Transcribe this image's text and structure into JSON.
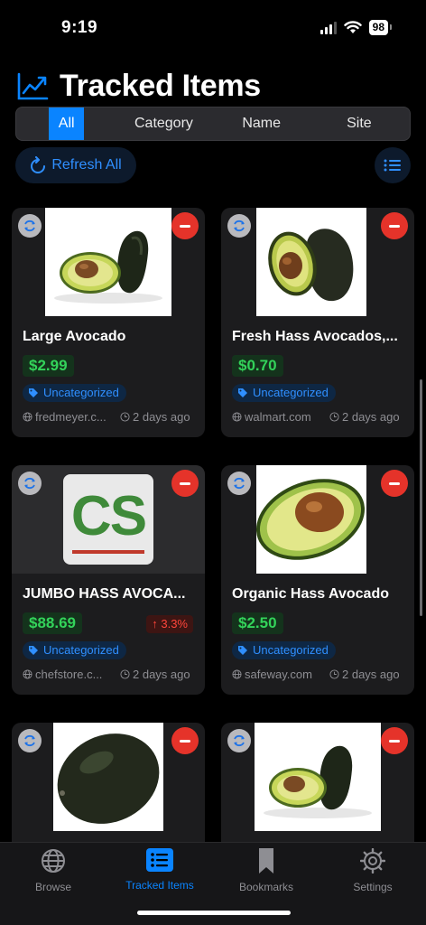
{
  "status_bar": {
    "time": "9:19",
    "battery": "98"
  },
  "header": {
    "title": "Tracked Items",
    "icon": "chart-line-icon"
  },
  "filter": {
    "options": [
      "All",
      "Category",
      "Name",
      "Site"
    ],
    "selected": "All"
  },
  "actions": {
    "refresh_all": "Refresh All"
  },
  "items": [
    {
      "name": "Large Avocado",
      "price": "$2.99",
      "change": "",
      "category": "Uncategorized",
      "site": "fredmeyer.c...",
      "updated": "2 days ago"
    },
    {
      "name": "Fresh Hass Avocados,...",
      "price": "$0.70",
      "change": "",
      "category": "Uncategorized",
      "site": "walmart.com",
      "updated": "2 days ago"
    },
    {
      "name": "JUMBO HASS AVOCA...",
      "price": "$88.69",
      "change": "3.3%",
      "category": "Uncategorized",
      "site": "chefstore.c...",
      "updated": "2 days ago",
      "logo_text": "CS"
    },
    {
      "name": "Organic Hass Avocado",
      "price": "$2.50",
      "change": "",
      "category": "Uncategorized",
      "site": "safeway.com",
      "updated": "2 days ago"
    },
    {
      "name": "",
      "price": "",
      "change": "",
      "category": "",
      "site": "",
      "updated": ""
    },
    {
      "name": "",
      "price": "",
      "change": "",
      "category": "",
      "site": "",
      "updated": ""
    }
  ],
  "tabs": [
    {
      "label": "Browse",
      "icon": "globe-icon"
    },
    {
      "label": "Tracked Items",
      "icon": "list-icon",
      "active": true
    },
    {
      "label": "Bookmarks",
      "icon": "bookmark-icon"
    },
    {
      "label": "Settings",
      "icon": "gear-icon"
    }
  ],
  "colors": {
    "accent": "#0a84ff",
    "price_green": "#33d35a",
    "remove_red": "#e5332a"
  }
}
